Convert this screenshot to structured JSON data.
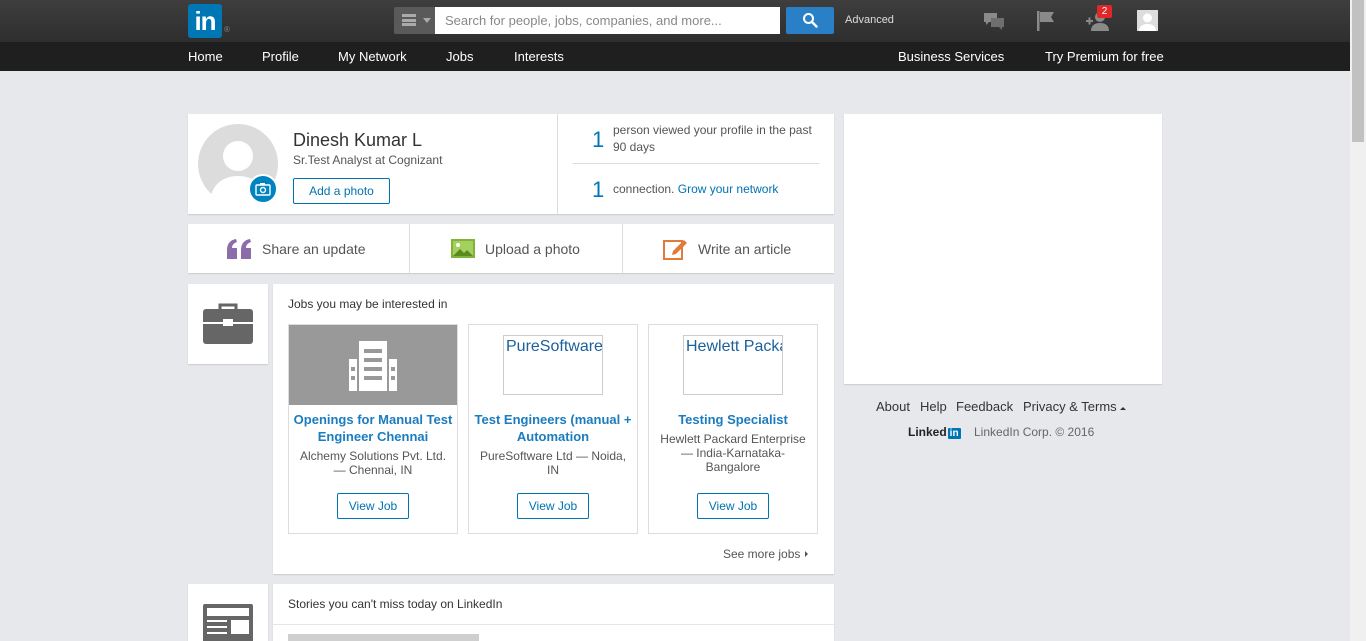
{
  "topbar": {
    "logo_text": "in",
    "logo_reg": "®",
    "search_placeholder": "Search for people, jobs, companies, and more...",
    "advanced_label": "Advanced",
    "notification_count": "2",
    "icons": [
      "messages-icon",
      "flag-icon",
      "add-connection-icon",
      "profile-avatar-icon"
    ],
    "brand_color": "#0077b5"
  },
  "nav": {
    "left": [
      "Home",
      "Profile",
      "My Network",
      "Jobs",
      "Interests"
    ],
    "business": "Business Services",
    "premium": "Try Premium for free"
  },
  "profile": {
    "name": "Dinesh Kumar L",
    "headline": "Sr.Test Analyst at Cognizant",
    "add_photo": "Add a photo"
  },
  "stats": {
    "views_count": "1",
    "views_text": "person viewed your profile in the past 90 days",
    "connections_count": "1",
    "connections_text": "connection.",
    "grow_link": "Grow your network"
  },
  "share": {
    "update": "Share an update",
    "photo": "Upload a photo",
    "article": "Write an article"
  },
  "jobs": {
    "title": "Jobs you may be interested in",
    "cards": [
      {
        "title": "Openings for Manual Test Engineer Chennai",
        "company": "Alchemy Solutions Pvt. Ltd. — Chennai, IN",
        "button": "View Job",
        "logo": ""
      },
      {
        "title": "Test Engineers (manual + Automation",
        "company": "PureSoftware Ltd — Noida, IN",
        "button": "View Job",
        "logo": "PureSoftware"
      },
      {
        "title": "Testing Specialist",
        "company": "Hewlett Packard Enterprise — India-Karnataka-Bangalore",
        "button": "View Job",
        "logo": "Hewlett Packard"
      }
    ],
    "see_more": "See more jobs"
  },
  "stories": {
    "title": "Stories you can't miss today on LinkedIn"
  },
  "footer": {
    "links": [
      "About",
      "Help",
      "Feedback",
      "Privacy & Terms"
    ],
    "logo_text": "Linked",
    "logo_in": "in",
    "copyright": "LinkedIn Corp. © 2016"
  }
}
